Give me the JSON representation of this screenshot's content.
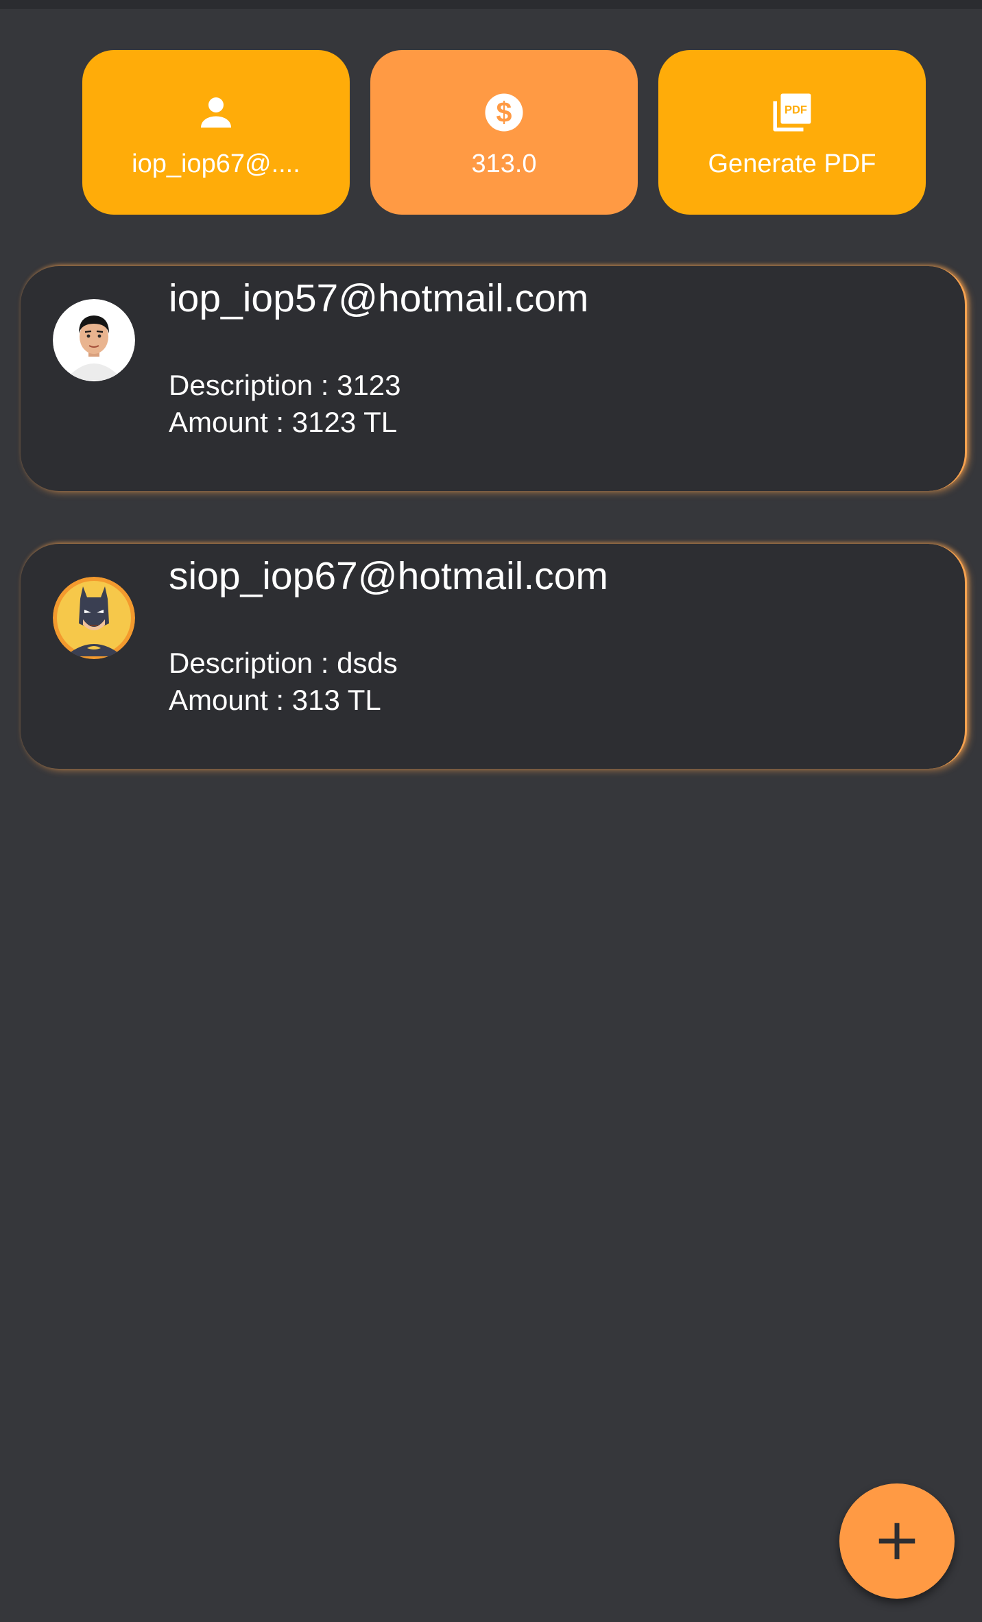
{
  "top_actions": {
    "user": {
      "label": "iop_iop67@....",
      "icon": "person-icon"
    },
    "total": {
      "label": "313.0",
      "icon": "dollar-circle-icon"
    },
    "pdf": {
      "label": "Generate PDF",
      "icon": "pdf-icon"
    }
  },
  "transactions": [
    {
      "email": "iop_iop57@hotmail.com",
      "description": "Description : 3123",
      "amount": "Amount : 3123 TL",
      "avatar": "man-avatar"
    },
    {
      "email": "siop_iop67@hotmail.com",
      "description": "Description : dsds",
      "amount": "Amount : 313 TL",
      "avatar": "batman-avatar"
    }
  ],
  "fab": {
    "icon": "plus-icon"
  },
  "colors": {
    "background": "#36373b",
    "card": "#2d2e32",
    "accent_yellow": "#ffac09",
    "accent_orange": "#ff9a44"
  }
}
